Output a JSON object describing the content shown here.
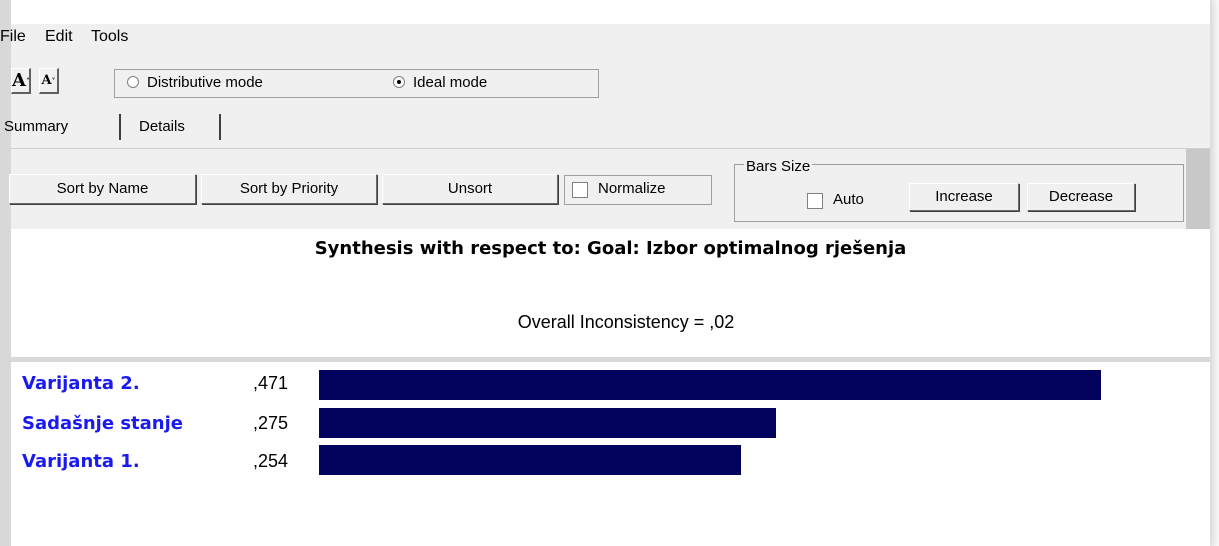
{
  "menu": [
    "File",
    "Edit",
    "Tools"
  ],
  "font_buttons": [
    "A",
    "A"
  ],
  "modes": {
    "distributive_label": "Distributive mode",
    "ideal_label": "Ideal mode",
    "selected": "Ideal mode"
  },
  "tabs": {
    "summary": "Summary",
    "details": "Details",
    "active": "Summary"
  },
  "toolbar": {
    "sort_by_name": "Sort by Name",
    "sort_by_priority": "Sort by Priority",
    "unsort": "Unsort",
    "normalize": "Normalize",
    "normalize_checked": false
  },
  "bars_size": {
    "title": "Bars Size",
    "auto_label": "Auto",
    "auto_checked": false,
    "increase": "Increase",
    "decrease": "Decrease"
  },
  "synthesis": {
    "title": "Synthesis with respect to: Goal: Izbor optimalnog rješenja",
    "inconsistency": "Overall Inconsistency = ,02"
  },
  "colors": {
    "bar": "#03035e",
    "alternative_name": "#1a1af0"
  },
  "chart_data": {
    "type": "bar",
    "orientation": "horizontal",
    "categories": [
      "Varijanta 2.",
      "Sadašnje stanje",
      "Varijanta 1."
    ],
    "values": [
      0.471,
      0.275,
      0.254
    ],
    "value_labels": [
      ",471",
      ",275",
      ",254"
    ]
  }
}
